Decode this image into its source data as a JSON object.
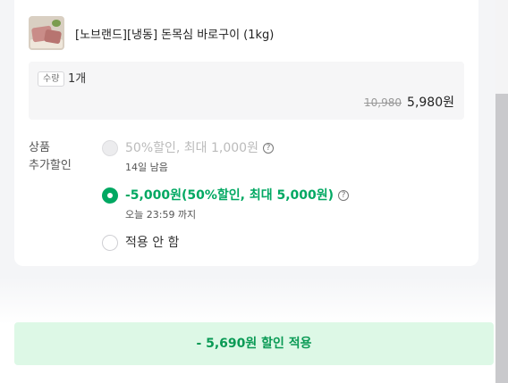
{
  "product": {
    "name": "[노브랜드][냉동] 돈목심 바로구이 (1kg)",
    "thumbnail_icon": "product-thumbnail-image"
  },
  "quantity": {
    "badge": "수량",
    "value": "1개",
    "price_original": "10,980",
    "price_current": "5,980원"
  },
  "discount": {
    "label_line1": "상품",
    "label_line2": "추가할인",
    "options": [
      {
        "title": "50%할인, 최대 1,000원",
        "sub": "14일 남음",
        "state": "disabled"
      },
      {
        "title": "-5,000원(50%할인, 최대 5,000원)",
        "sub": "오늘 23:59 까지",
        "state": "selected"
      },
      {
        "title": "적용 안 함",
        "state": "unselected"
      }
    ],
    "help_glyph": "?"
  },
  "apply_button": {
    "label": "- 5,690원 할인 적용"
  },
  "colors": {
    "accent_green": "#00a862",
    "button_bg": "#ddf8e6"
  }
}
